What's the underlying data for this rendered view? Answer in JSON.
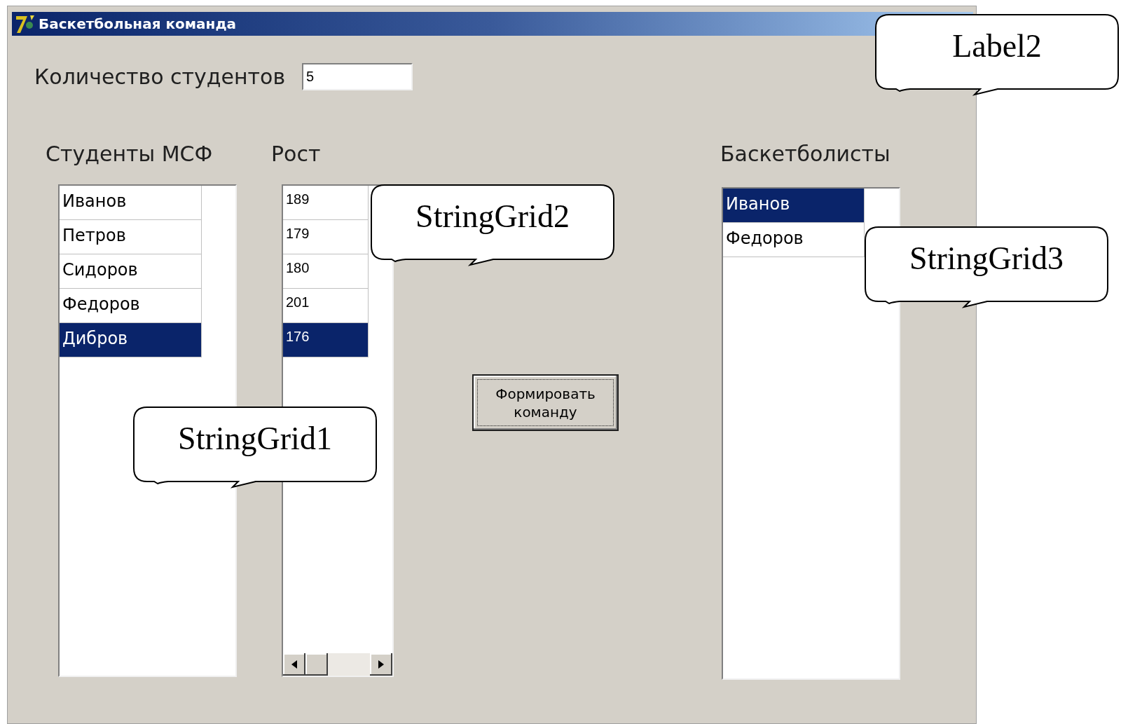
{
  "window": {
    "title": "Баскетбольная команда"
  },
  "count": {
    "label": "Количество студентов",
    "value": "5"
  },
  "grids": [
    {
      "label": "Студенты МСФ",
      "kind": "names",
      "rows": [
        {
          "text": "Иванов",
          "selected": false
        },
        {
          "text": "Петров",
          "selected": false
        },
        {
          "text": "Сидоров",
          "selected": false
        },
        {
          "text": "Федоров",
          "selected": false
        },
        {
          "text": "Дибров",
          "selected": true
        }
      ]
    },
    {
      "label": "Рост",
      "kind": "numbers",
      "rows": [
        {
          "text": "189",
          "selected": false
        },
        {
          "text": "179",
          "selected": false
        },
        {
          "text": "180",
          "selected": false
        },
        {
          "text": "201",
          "selected": false
        },
        {
          "text": "176",
          "selected": true
        }
      ]
    },
    {
      "label": "Баскетболисты",
      "kind": "names",
      "rows": [
        {
          "text": "Иванов",
          "selected": true
        },
        {
          "text": "Федоров",
          "selected": false
        }
      ]
    }
  ],
  "button": {
    "label": "Формировать команду"
  },
  "callouts": [
    {
      "text": "Label2"
    },
    {
      "text": "StringGrid2"
    },
    {
      "text": "StringGrid3"
    },
    {
      "text": "StringGrid1"
    }
  ]
}
